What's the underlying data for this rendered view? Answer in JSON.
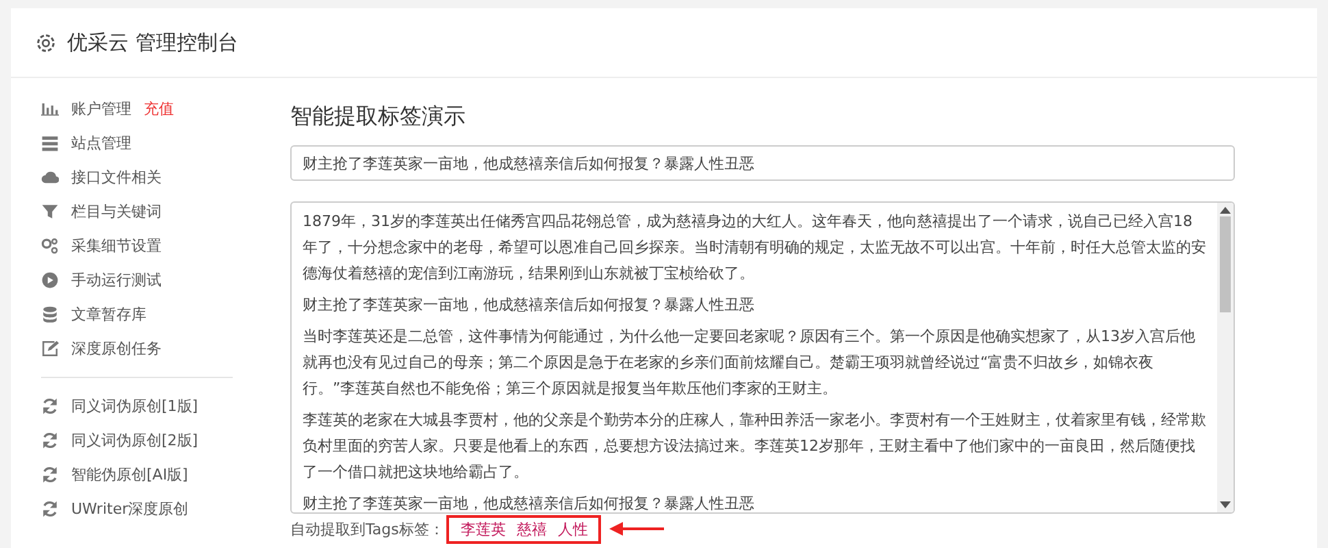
{
  "header": {
    "title": "优采云 管理控制台"
  },
  "sidebar": {
    "groups": [
      {
        "items": [
          {
            "label": "账户管理",
            "badge": "充值"
          },
          {
            "label": "站点管理"
          },
          {
            "label": "接口文件相关"
          },
          {
            "label": "栏目与关键词"
          },
          {
            "label": "采集细节设置"
          },
          {
            "label": "手动运行测试"
          },
          {
            "label": "文章暂存库"
          },
          {
            "label": "深度原创任务"
          }
        ]
      },
      {
        "items": [
          {
            "label": "同义词伪原创[1版]"
          },
          {
            "label": "同义词伪原创[2版]"
          },
          {
            "label": "智能伪原创[AI版]"
          },
          {
            "label": "UWriter深度原创"
          }
        ]
      }
    ]
  },
  "main": {
    "title": "智能提取标签演示",
    "title_input": {
      "value": "财主抢了李莲英家一亩地，他成慈禧亲信后如何报复？暴露人性丑恶"
    },
    "article": {
      "paragraphs": [
        "1879年，31岁的李莲英出任储秀宫四品花翎总管，成为慈禧身边的大红人。这年春天，他向慈禧提出了一个请求，说自己已经入宫18年了，十分想念家中的老母，希望可以恩准自己回乡探亲。当时清朝有明确的规定，太监无故不可以出宫。十年前，时任大总管太监的安德海仗着慈禧的宠信到江南游玩，结果刚到山东就被丁宝桢给砍了。",
        "财主抢了李莲英家一亩地，他成慈禧亲信后如何报复？暴露人性丑恶",
        "当时李莲英还是二总管，这件事情为何能通过，为什么他一定要回老家呢？原因有三个。第一个原因是他确实想家了，从13岁入宫后他就再也没有见过自己的母亲；第二个原因是急于在老家的乡亲们面前炫耀自己。楚霸王项羽就曾经说过“富贵不归故乡，如锦衣夜行。”李莲英自然也不能免俗；第三个原因就是报复当年欺压他们李家的王财主。",
        "李莲英的老家在大城县李贾村，他的父亲是个勤劳本分的庄稼人，靠种田养活一家老小。李贾村有一个王姓财主，仗着家里有钱，经常欺负村里面的穷苦人家。只要是他看上的东西，总要想方设法搞过来。李莲英12岁那年，王财主看中了他们家中的一亩良田，然后随便找了一个借口就把这块地给霸占了。",
        "财主抢了李莲英家一亩地，他成慈禧亲信后如何报复？暴露人性丑恶"
      ]
    },
    "tags": {
      "label": "自动提取到Tags标签：",
      "items": [
        "李莲英",
        "慈禧",
        "人性"
      ]
    }
  }
}
